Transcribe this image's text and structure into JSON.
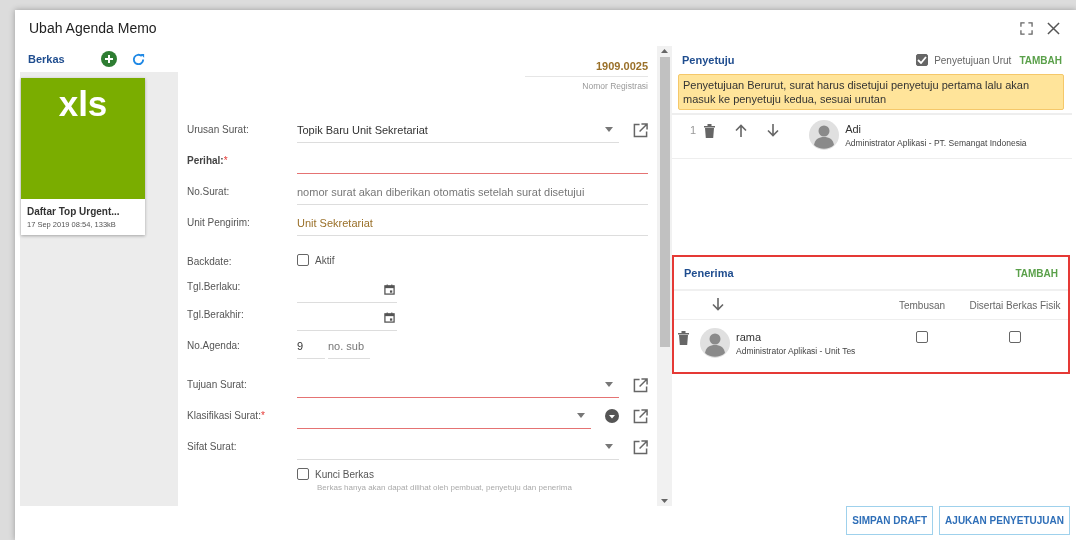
{
  "dialog": {
    "title": "Ubah Agenda Memo"
  },
  "files": {
    "title": "Berkas",
    "items": [
      {
        "badge": "xls",
        "name": "Daftar Top Urgent...",
        "meta": "17 Sep 2019 08:54, 133kB"
      }
    ]
  },
  "registration": {
    "value": "1909.0025",
    "label": "Nomor Registrasi"
  },
  "form": {
    "fields": [
      {
        "kind": "select",
        "label": "Urusan Surat:",
        "value": "Topik Baru Unit Sekretariat",
        "invalid": false,
        "emphasized": false
      },
      {
        "kind": "text",
        "label": "Perihal:",
        "required_mark": "*",
        "invalid": true,
        "emphasized": true
      },
      {
        "kind": "text",
        "label": "No.Surat:",
        "placeholder": "nomor surat akan diberikan otomatis setelah surat disetujui",
        "invalid": false,
        "emphasized": false
      },
      {
        "kind": "readonly",
        "label": "Unit Pengirim:",
        "value": "Unit Sekretariat",
        "emphasized": false
      },
      {
        "kind": "checkbox",
        "label": "Backdate:",
        "option": "Aktif",
        "checked": false,
        "emphasized": false
      },
      {
        "kind": "date",
        "label": "Tgl.Berlaku:",
        "emphasized": false
      },
      {
        "kind": "date",
        "label": "Tgl.Berakhir:",
        "emphasized": false
      },
      {
        "kind": "agenda",
        "label": "No.Agenda:",
        "value": "9",
        "sub_placeholder": "no. sub",
        "emphasized": false
      },
      {
        "kind": "select",
        "label": "Tujuan Surat:",
        "invalid": true,
        "emphasized": false
      },
      {
        "kind": "select",
        "label": "Klasifikasi Surat:",
        "required_mark": "*",
        "invalid": true,
        "picker": true,
        "emphasized": false
      },
      {
        "kind": "select",
        "label": "Sifat Surat:",
        "invalid": false,
        "emphasized": false
      },
      {
        "kind": "option",
        "option": "Kunci Berkas",
        "hint": "Berkas hanya akan dapat dilihat oleh pembuat, penyetuju dan penerima",
        "checked": false
      }
    ]
  },
  "approvers": {
    "title": "Penyetuju",
    "sequential": {
      "label": "Penyetujuan Urut",
      "checked": true
    },
    "add": "TAMBAH",
    "notice": "Penyetujuan Berurut, surat harus disetujui penyetuju pertama lalu akan masuk ke penyetuju kedua, sesuai urutan",
    "items": [
      {
        "index": "1",
        "name": "Adi",
        "role": "Administrator Aplikasi - PT. Semangat Indonesia"
      }
    ]
  },
  "recipients": {
    "title": "Penerima",
    "add": "TAMBAH",
    "highlighted": true,
    "columns": [
      "Tembusan",
      "Disertai Berkas Fisik"
    ],
    "items": [
      {
        "name": "rama",
        "role": "Administrator Aplikasi - Unit Tes",
        "cc": false,
        "physical": false
      }
    ]
  },
  "buttons": [
    "SIMPAN DRAFT",
    "AJUKAN PENYETUJUAN"
  ]
}
